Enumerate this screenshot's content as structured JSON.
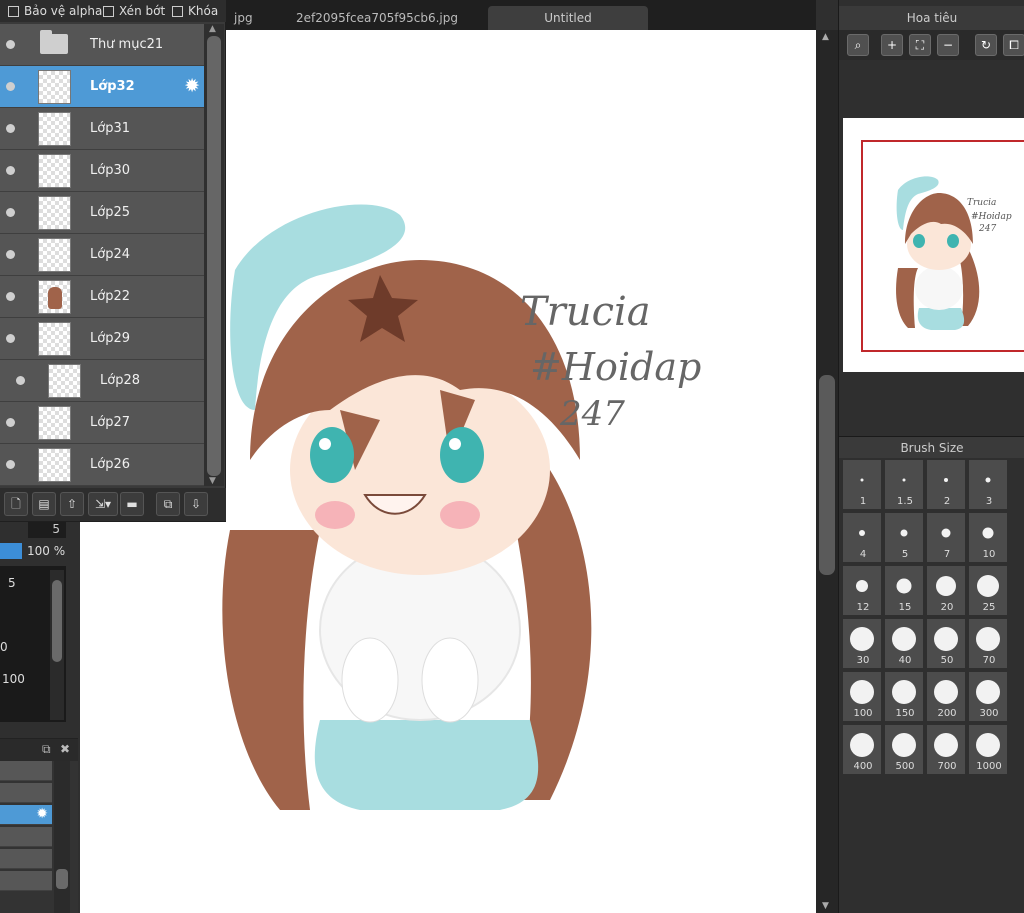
{
  "tabs": [
    {
      "label": "jpg"
    },
    {
      "label": "2ef2095fcea705f95cb6.jpg"
    },
    {
      "label": "Untitled"
    }
  ],
  "layer_panel": {
    "options": [
      {
        "label": "Bảo vệ alpha"
      },
      {
        "label": "Xén bớt"
      },
      {
        "label": "Khóa"
      }
    ],
    "layers": [
      {
        "name": "Thư mục21",
        "type": "folder",
        "selected": false
      },
      {
        "name": "Lớp32",
        "type": "layer",
        "selected": true
      },
      {
        "name": "Lớp31",
        "type": "layer",
        "selected": false
      },
      {
        "name": "Lớp30",
        "type": "layer",
        "selected": false
      },
      {
        "name": "Lớp25",
        "type": "layer",
        "selected": false
      },
      {
        "name": "Lớp24",
        "type": "layer",
        "selected": false
      },
      {
        "name": "Lớp22",
        "type": "layer",
        "selected": false
      },
      {
        "name": "Lớp29",
        "type": "layer",
        "selected": false
      },
      {
        "name": "Lớp28",
        "type": "layer",
        "selected": false,
        "indented": true
      },
      {
        "name": "Lớp27",
        "type": "layer",
        "selected": false
      },
      {
        "name": "Lớp26",
        "type": "layer",
        "selected": false
      }
    ]
  },
  "left_strip": {
    "field_value": "5",
    "opacity_label": "100 %",
    "values": [
      "5",
      "0",
      "100"
    ]
  },
  "navigator": {
    "title": "Hoa tiêu",
    "preview_text": [
      "Trucia",
      "#Hoidap",
      "247"
    ]
  },
  "canvas_text": [
    "Trucia",
    "#Hoidap",
    "247"
  ],
  "brush_size": {
    "title": "Brush Size",
    "sizes": [
      "1",
      "1.5",
      "2",
      "3",
      "4",
      "5",
      "7",
      "10",
      "12",
      "15",
      "20",
      "25",
      "30",
      "40",
      "50",
      "70",
      "100",
      "150",
      "200",
      "300",
      "400",
      "500",
      "700",
      "1000"
    ]
  },
  "colors": {
    "selection": "#4e9ad6",
    "navigator_frame": "#c0282b",
    "hair": "#a0634a",
    "hat": "#a8dde0"
  }
}
